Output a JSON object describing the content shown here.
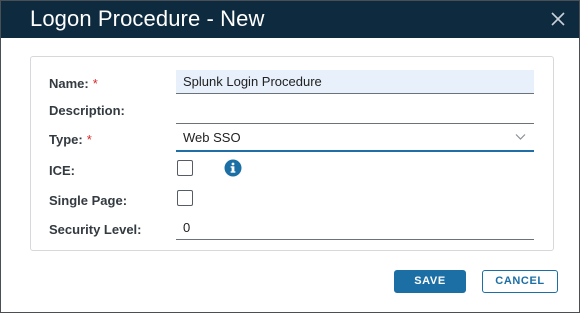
{
  "dialog": {
    "title": "Logon Procedure - New",
    "close_icon": "close-icon"
  },
  "form": {
    "name": {
      "label": "Name:",
      "required_mark": "*",
      "value": "Splunk Login Procedure"
    },
    "description": {
      "label": "Description:",
      "value": ""
    },
    "type": {
      "label": "Type:",
      "required_mark": "*",
      "value": "Web SSO",
      "icon": "chevron-down-icon"
    },
    "ice": {
      "label": "ICE:",
      "checked": false,
      "info_icon": "info-icon"
    },
    "single_page": {
      "label": "Single Page:",
      "checked": false
    },
    "security_level": {
      "label": "Security Level:",
      "value": "0"
    }
  },
  "buttons": {
    "save_label": "SAVE",
    "cancel_label": "CANCEL"
  },
  "colors": {
    "titlebar": "#0d2a3f",
    "accent": "#1b6fa5",
    "required": "#d62828",
    "filled_input": "#e7f0fb"
  }
}
